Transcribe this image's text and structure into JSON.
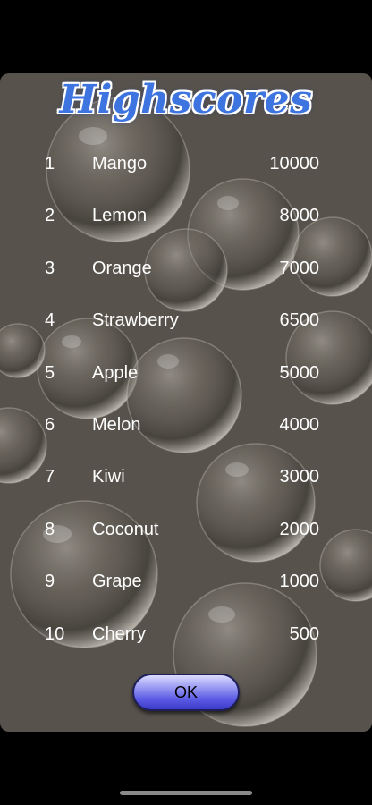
{
  "title": "Highscores",
  "scores": [
    {
      "rank": "1",
      "name": "Mango",
      "score": "10000"
    },
    {
      "rank": "2",
      "name": "Lemon",
      "score": "8000"
    },
    {
      "rank": "3",
      "name": "Orange",
      "score": "7000"
    },
    {
      "rank": "4",
      "name": "Strawberry",
      "score": "6500"
    },
    {
      "rank": "5",
      "name": "Apple",
      "score": "5000"
    },
    {
      "rank": "6",
      "name": "Melon",
      "score": "4000"
    },
    {
      "rank": "7",
      "name": "Kiwi",
      "score": "3000"
    },
    {
      "rank": "8",
      "name": "Coconut",
      "score": "2000"
    },
    {
      "rank": "9",
      "name": "Grape",
      "score": "1000"
    },
    {
      "rank": "10",
      "name": "Cherry",
      "score": "500"
    }
  ],
  "ok_button": {
    "label": "OK"
  },
  "colors": {
    "panel": "#57524b",
    "title": "#3d74e0",
    "button": "#5b5be6",
    "text": "#ffffff"
  }
}
